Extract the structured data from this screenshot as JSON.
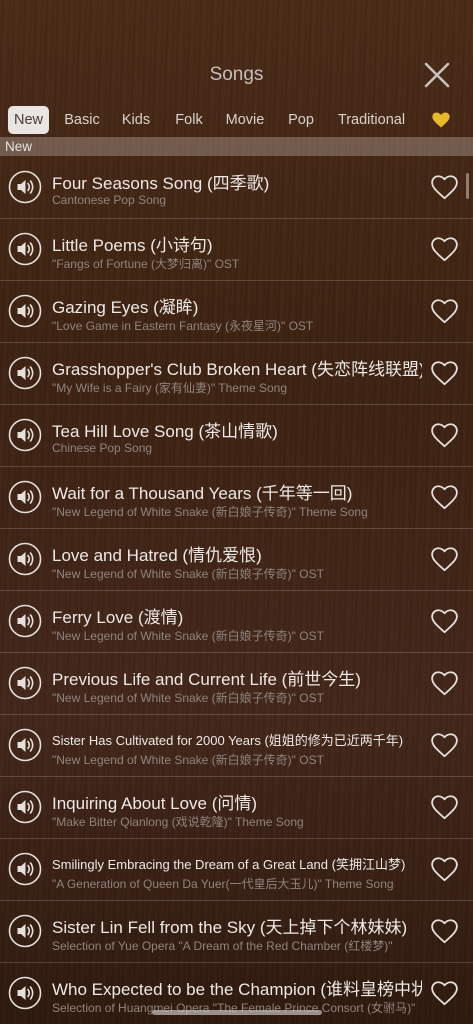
{
  "header": {
    "title": "Songs"
  },
  "tabs": [
    {
      "label": "New",
      "active": true
    },
    {
      "label": "Basic"
    },
    {
      "label": "Kids"
    },
    {
      "label": "Folk"
    },
    {
      "label": "Movie"
    },
    {
      "label": "Pop"
    },
    {
      "label": "Traditional"
    }
  ],
  "favorites_tab_icon": "heart-icon-gold",
  "section": {
    "label": "New"
  },
  "colors": {
    "accent_gold": "#e8b929",
    "text_primary": "#eee9e6",
    "text_secondary": "#8f847e"
  },
  "songs": [
    {
      "title": "Four Seasons Song (四季歌)",
      "subtitle": "Cantonese Pop Song"
    },
    {
      "title": "Little Poems (小诗句)",
      "subtitle": "\"Fangs of Fortune (大梦归离)\" OST"
    },
    {
      "title": "Gazing Eyes (凝眸)",
      "subtitle": "\"Love Game in Eastern Fantasy (永夜星河)\" OST"
    },
    {
      "title": "Grasshopper's Club Broken Heart (失恋阵线联盟)",
      "subtitle": "\"My Wife is a Fairy (家有仙妻)\" Theme Song"
    },
    {
      "title": "Tea Hill Love Song (茶山情歌)",
      "subtitle": "Chinese Pop Song"
    },
    {
      "title": "Wait for a Thousand Years (千年等一回)",
      "subtitle": "\"New Legend of White Snake (新白娘子传奇)\" Theme Song"
    },
    {
      "title": "Love and Hatred (情仇爱恨)",
      "subtitle": "\"New Legend of White Snake (新白娘子传奇)\" OST"
    },
    {
      "title": "Ferry Love (渡情)",
      "subtitle": "\"New Legend of White Snake (新白娘子传奇)\" OST"
    },
    {
      "title": "Previous Life and Current Life (前世今生)",
      "subtitle": "\"New Legend of White Snake (新白娘子传奇)\" OST"
    },
    {
      "title": "Sister Has Cultivated for 2000 Years (姐姐的修为已近两千年)",
      "subtitle": "\"New Legend of White Snake (新白娘子传奇)\" OST"
    },
    {
      "title": "Inquiring About Love (问情)",
      "subtitle": "\"Make Bitter Qianlong (戏说乾隆)\" Theme Song"
    },
    {
      "title": "Smilingly Embracing the Dream of a Great Land (笑拥江山梦)",
      "subtitle": "\"A Generation of Queen Da Yuer(一代皇后大玉儿)\" Theme Song"
    },
    {
      "title": "Sister Lin Fell from the Sky (天上掉下个林妹妹)",
      "subtitle": "Selection of Yue Opera \"A Dream of the Red Chamber (红楼梦)\""
    },
    {
      "title": "Who Expected to be the Champion (谁料皇榜中状元)",
      "subtitle": "Selection of Huangmei Opera \"The Female Prince Consort (女驸马)\""
    }
  ]
}
